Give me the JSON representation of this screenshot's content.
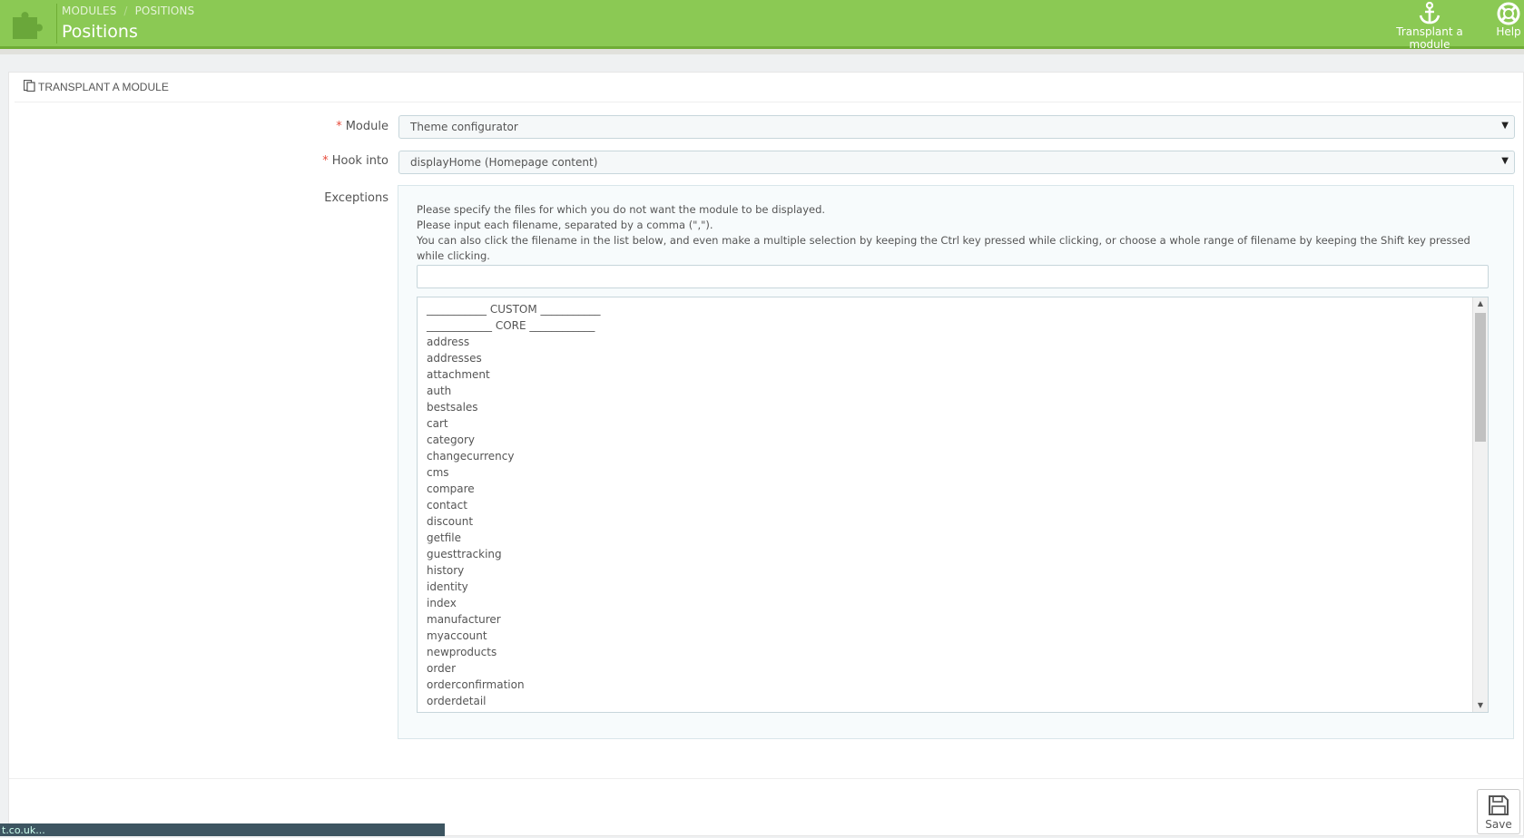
{
  "header": {
    "breadcrumb": [
      "MODULES",
      "POSITIONS"
    ],
    "breadcrumb_separator": "/",
    "title": "Positions",
    "toolbar": [
      {
        "label": "Transplant a module",
        "icon": "anchor-icon"
      },
      {
        "label": "Help",
        "icon": "lifebuoy-icon"
      }
    ],
    "colors": {
      "accent": "#8bc954",
      "accent_dark": "#6fad35"
    }
  },
  "panel": {
    "heading": "TRANSPLANT A MODULE",
    "heading_icon": "transplant-icon",
    "module": {
      "label": "Module",
      "required_mark": "*",
      "value": "Theme configurator"
    },
    "hook": {
      "label": "Hook into",
      "required_mark": "*",
      "value": "displayHome (Homepage content)"
    },
    "exceptions": {
      "label": "Exceptions",
      "help": [
        "Please specify the files for which you do not want the module to be displayed.",
        "Please input each filename, separated by a comma (\",\").",
        "You can also click the filename in the list below, and even make a multiple selection by keeping the Ctrl key pressed while clicking, or choose a whole range of filename by keeping the Shift key pressed while clicking."
      ],
      "input_value": "",
      "files": [
        "___________ CUSTOM ___________",
        "____________ CORE ____________",
        "address",
        "addresses",
        "attachment",
        "auth",
        "bestsales",
        "cart",
        "category",
        "changecurrency",
        "cms",
        "compare",
        "contact",
        "discount",
        "getfile",
        "guesttracking",
        "history",
        "identity",
        "index",
        "manufacturer",
        "myaccount",
        "newproducts",
        "order",
        "orderconfirmation",
        "orderdetail"
      ]
    },
    "save_label": "Save"
  },
  "status_bar": "t.co.uk..."
}
